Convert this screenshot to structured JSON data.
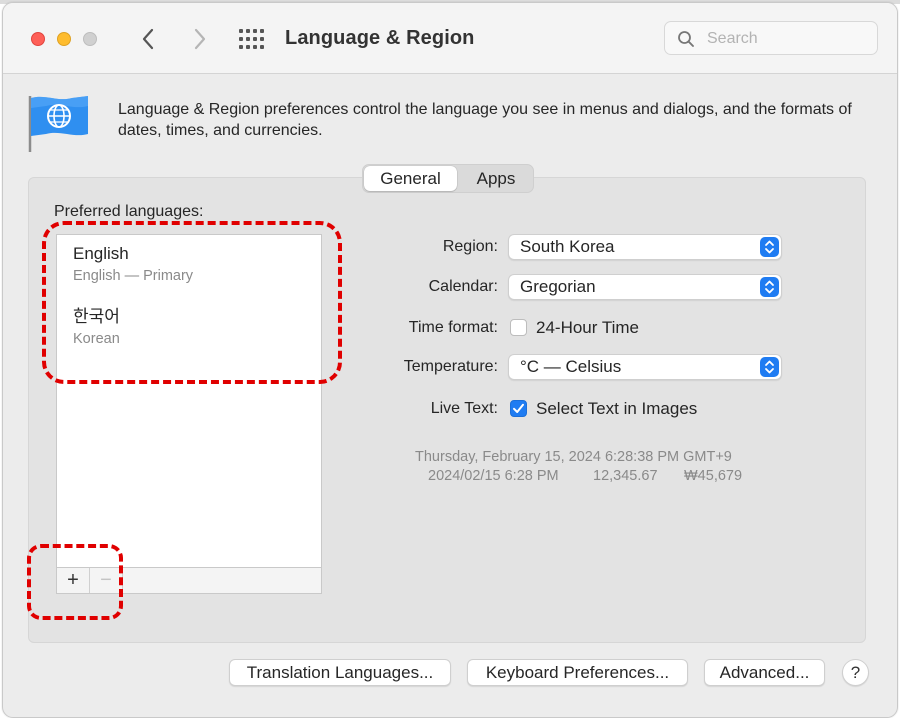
{
  "window": {
    "title": "Language & Region",
    "search_placeholder": "Search"
  },
  "header": {
    "description": "Language & Region preferences control the language you see in menus and dialogs, and the formats of dates, times, and currencies."
  },
  "tabs": [
    {
      "label": "General",
      "selected": true
    },
    {
      "label": "Apps",
      "selected": false
    }
  ],
  "preferred_languages": {
    "label": "Preferred languages:",
    "items": [
      {
        "name": "English",
        "detail": "English — Primary"
      },
      {
        "name": "한국어",
        "detail": "Korean"
      }
    ],
    "add_label": "+",
    "remove_label": "−"
  },
  "settings": {
    "region_label": "Region:",
    "region_value": "South Korea",
    "calendar_label": "Calendar:",
    "calendar_value": "Gregorian",
    "time_format_label": "Time format:",
    "time_format_checkbox": "24-Hour Time",
    "time_format_checked": false,
    "temperature_label": "Temperature:",
    "temperature_value": "°C — Celsius",
    "live_text_label": "Live Text:",
    "live_text_checkbox": "Select Text in Images",
    "live_text_checked": true
  },
  "sample": {
    "datetime_long": "Thursday, February 15, 2024 6:28:38 PM GMT+9",
    "datetime_short": "2024/02/15 6:28 PM",
    "number": "12,345.67",
    "currency": "₩45,679"
  },
  "buttons": {
    "translation_languages": "Translation Languages...",
    "keyboard_preferences": "Keyboard Preferences...",
    "advanced": "Advanced...",
    "help": "?"
  },
  "colors": {
    "accent": "#1f7cf2",
    "annotation": "#e00000"
  }
}
